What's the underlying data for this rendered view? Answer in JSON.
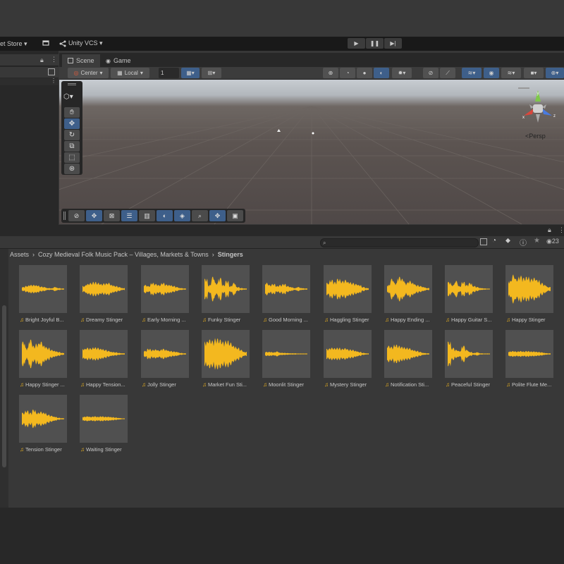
{
  "menubar": {
    "asset_store": "et Store ▾",
    "cloud_icon": "package-icon",
    "vcs": "Unity VCS ▾"
  },
  "play": {
    "play": "▶",
    "pause": "❚❚",
    "step": "▶|"
  },
  "scene": {
    "tabs": [
      {
        "label": "Scene",
        "icon": "grid-icon"
      },
      {
        "label": "Game",
        "icon": "gamepad-icon"
      }
    ],
    "pivot": "Center",
    "space": "Local",
    "grid_snap": "1",
    "persp_label": "Persp"
  },
  "project": {
    "search_placeholder": "",
    "eye_count": "23",
    "breadcrumb": [
      "Assets",
      "Cozy Medieval Folk Music Pack – Villages, Markets & Towns",
      "Stingers"
    ],
    "assets": [
      {
        "label": "Bright Joyful B..."
      },
      {
        "label": "Dreamy Stinger"
      },
      {
        "label": "Early Morning ..."
      },
      {
        "label": "Funky Stinger"
      },
      {
        "label": "Good Morning ..."
      },
      {
        "label": "Haggling Stinger"
      },
      {
        "label": "Happy Ending ..."
      },
      {
        "label": "Happy Guitar S..."
      },
      {
        "label": "Happy Stinger"
      },
      {
        "label": "Happy Stinger ..."
      },
      {
        "label": "Happy Tension..."
      },
      {
        "label": "Jolly Stinger"
      },
      {
        "label": "Market Fun Sti..."
      },
      {
        "label": "Moonlit Stinger"
      },
      {
        "label": "Mystery Stinger"
      },
      {
        "label": "Notification Sti..."
      },
      {
        "label": "Peaceful Stinger"
      },
      {
        "label": "Polite Flute Me..."
      },
      {
        "label": "Tension Stinger"
      },
      {
        "label": "Waiting Stinger"
      }
    ]
  },
  "colors": {
    "waveform": "#f3b81f",
    "thumb_bg": "#505050",
    "active_blue": "#3e5f8a"
  }
}
